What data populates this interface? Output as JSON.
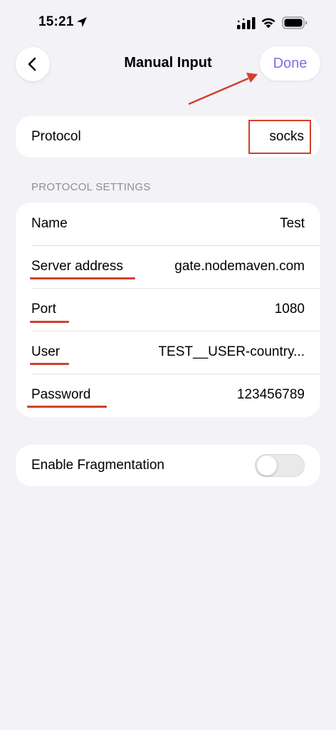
{
  "status_bar": {
    "time": "15:21"
  },
  "nav": {
    "title": "Manual Input",
    "done_label": "Done",
    "back_icon": "chevron-left-icon"
  },
  "protocol": {
    "label": "Protocol",
    "value": "socks"
  },
  "section_header": "PROTOCOL SETTINGS",
  "settings": [
    {
      "label": "Name",
      "value": "Test"
    },
    {
      "label": "Server address",
      "value": "gate.nodemaven.com"
    },
    {
      "label": "Port",
      "value": "1080"
    },
    {
      "label": "User",
      "value": "TEST__USER-country..."
    },
    {
      "label": "Password",
      "value": "123456789"
    }
  ],
  "fragmentation": {
    "label": "Enable Fragmentation",
    "enabled": false
  },
  "colors": {
    "accent": "#7b6ee6",
    "annotation": "#d0412b",
    "background": "#f2f2f7"
  }
}
